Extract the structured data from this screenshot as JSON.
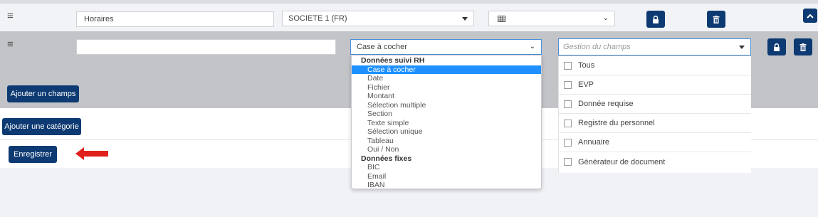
{
  "header": {
    "name_value": "Horaires",
    "company_value": "SOCIETE 1 (FR)",
    "type_icon": "grid-icon"
  },
  "field_row": {
    "name_value": "",
    "type_value": "Case à cocher",
    "gestion_placeholder": "Gestion du champs"
  },
  "type_dropdown": {
    "groups": [
      {
        "label": "Données suivi RH",
        "items": [
          "Case à cocher",
          "Date",
          "Fichier",
          "Montant",
          "Sélection multiple",
          "Section",
          "Texte simple",
          "Sélection unique",
          "Tableau",
          "Oui / Non"
        ]
      },
      {
        "label": "Données fixes",
        "items": [
          "BIC",
          "Email",
          "IBAN"
        ]
      }
    ],
    "selected": "Case à cocher"
  },
  "gestion_options": [
    "Tous",
    "EVP",
    "Donnée requise",
    "Registre du personnel",
    "Annuaire",
    "Générateur de document"
  ],
  "buttons": {
    "add_field": "Ajouter un champs",
    "add_category": "Ajouter une catégorie",
    "save": "Enregistrer"
  },
  "colors": {
    "primary": "#0d3a72",
    "selected_option": "#1e90ff",
    "arrow": "#e0201c"
  }
}
